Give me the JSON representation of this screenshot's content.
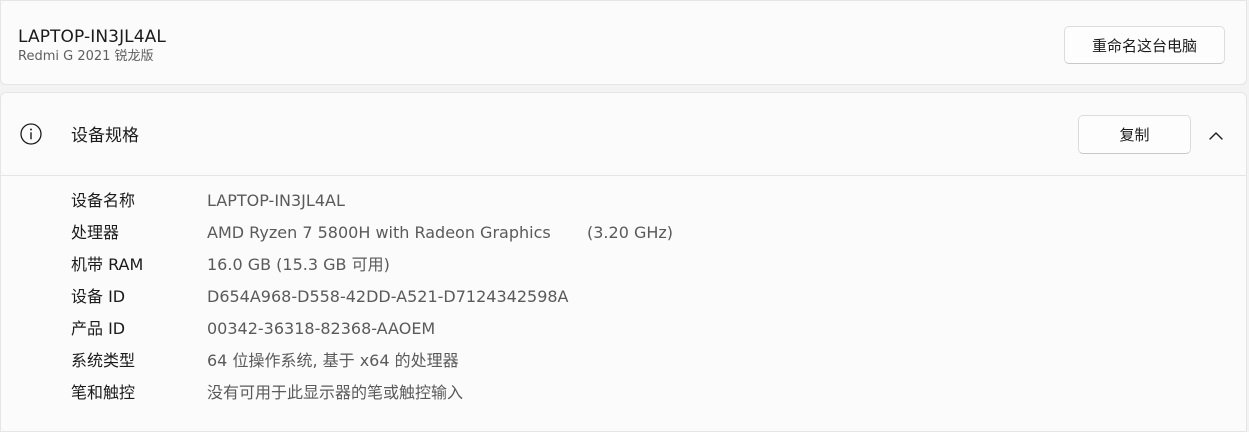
{
  "device": {
    "name": "LAPTOP-IN3JL4AL",
    "model": "Redmi G 2021 锐龙版",
    "rename_label": "重命名这台电脑"
  },
  "specs": {
    "title": "设备规格",
    "copy_label": "复制",
    "icons": {
      "info": "info-icon",
      "collapse": "chevron-up-icon"
    },
    "rows": [
      {
        "label": "设备名称",
        "value": "LAPTOP-IN3JL4AL",
        "extra": ""
      },
      {
        "label": "处理器",
        "value": "AMD Ryzen 7 5800H with Radeon Graphics",
        "extra": "(3.20 GHz)"
      },
      {
        "label": "机带 RAM",
        "value": "16.0 GB (15.3 GB 可用)",
        "extra": ""
      },
      {
        "label": "设备 ID",
        "value": "D654A968-D558-42DD-A521-D7124342598A",
        "extra": ""
      },
      {
        "label": "产品 ID",
        "value": "00342-36318-82368-AAOEM",
        "extra": ""
      },
      {
        "label": "系统类型",
        "value": "64 位操作系统, 基于 x64 的处理器",
        "extra": ""
      },
      {
        "label": "笔和触控",
        "value": "没有可用于此显示器的笔或触控输入",
        "extra": ""
      }
    ]
  }
}
